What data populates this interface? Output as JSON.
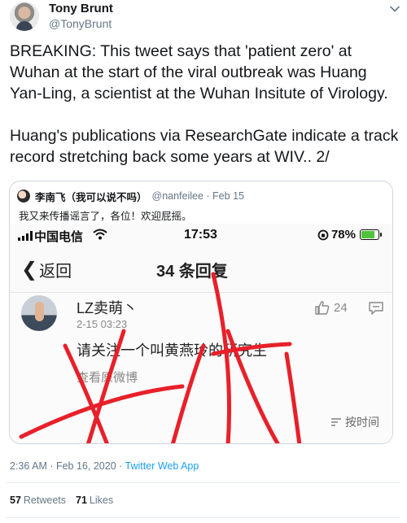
{
  "author": {
    "display_name": "Tony Brunt",
    "handle": "@TonyBrunt"
  },
  "tweet": {
    "paragraphs": [
      "BREAKING: This tweet says that 'patient zero' at Wuhan at the start of the viral outbreak was Huang Yan-Ling, a scientist at the Wuhan Insitute of Virology.",
      "Huang's publications via ResearchGate indicate a track record stretching back some years at WIV.. 2/"
    ],
    "timestamp": "2:36 AM · Feb 16, 2020 · ",
    "source": "Twitter Web App",
    "retweets_count": "57",
    "retweets_label": "Retweets",
    "likes_count": "71",
    "likes_label": "Likes"
  },
  "quoted_tweet": {
    "name": "李南飞（我可以说不吗）",
    "handle_date": "@nanfeilee · Feb 15",
    "text": "我又来传播谣言了，各位！欢迎屁摇。",
    "screenshot": {
      "carrier": "中国电信",
      "time": "17:53",
      "battery": "78%",
      "battery_level": 0.78,
      "back_label": "返回",
      "title": "34 条回复",
      "comment": {
        "user": "LZ卖萌丶",
        "time": "2-15 03:23",
        "likes": "24",
        "text": "请关注一个叫黄燕玲的研究生",
        "link": "查看原微博"
      },
      "sort_label": "按时间"
    }
  },
  "icons": {
    "chevron": "chevron-down-icon",
    "signal": "signal-icon",
    "wifi": "wifi-icon",
    "battery": "battery-icon",
    "back": "back-arrow-icon",
    "like": "thumbs-up-icon",
    "reply": "comment-icon",
    "sort": "sort-icon"
  },
  "colors": {
    "link": "#1da1f2",
    "scribble": "#e8202a",
    "battery_fill": "#53c23b"
  }
}
